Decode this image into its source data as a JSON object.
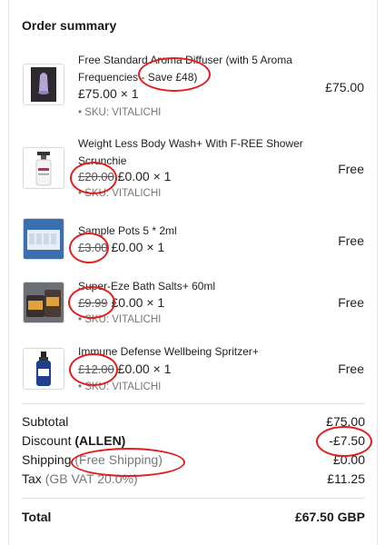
{
  "summary": {
    "title": "Order summary"
  },
  "items": [
    {
      "name": "Free Standard Aroma Diffuser (with 5 Aroma Frequencies - Save £48)",
      "price_line": "£75.00 × 1",
      "sku": "• SKU: VITALICHI",
      "total": "£75.00",
      "thumb": "aroma-diffuser"
    },
    {
      "name": "Weight Less Body Wash+ With F-REE Shower Scrunchie",
      "old_price": "£20.00",
      "price_line": "£0.00 × 1",
      "sku": "• SKU: VITALICHI",
      "total": "Free",
      "thumb": "body-wash-bottle"
    },
    {
      "name": "Sample Pots 5 * 2ml",
      "old_price": "£3.00",
      "price_line": "£0.00 × 1",
      "sku": "",
      "total": "Free",
      "thumb": "sample-pots"
    },
    {
      "name": "Super-Eze Bath Salts+ 60ml",
      "old_price": "£9.99",
      "price_line": "£0.00 × 1",
      "sku": "• SKU: VITALICHI",
      "total": "Free",
      "thumb": "bath-salts-jars"
    },
    {
      "name": "Immune Defense Wellbeing Spritzer+",
      "old_price": "£12.00",
      "price_line": "£0.00 × 1",
      "sku": "• SKU: VITALICHI",
      "total": "Free",
      "thumb": "spritzer-bottle"
    }
  ],
  "totals": {
    "subtotal_label": "Subtotal",
    "subtotal_value": "£75.00",
    "discount_label": "Discount",
    "discount_code": "(ALLEN)",
    "discount_value": "-£7.50",
    "shipping_label": "Shipping",
    "shipping_note": "(Free Shipping)",
    "shipping_value": "£0.00",
    "tax_label": "Tax",
    "tax_note": "(GB VAT 20.0%)",
    "tax_value": "£11.25",
    "total_label": "Total",
    "total_value": "£67.50 GBP"
  },
  "annotation_color": "#e31c1c"
}
